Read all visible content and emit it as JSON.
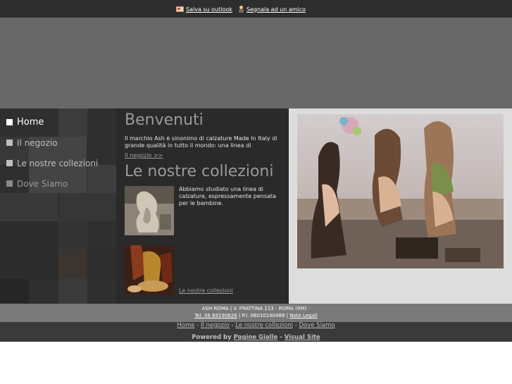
{
  "topbar": {
    "save_outlook": " Salva su outlook",
    "tell_friend": " Segnala ad un amico"
  },
  "nav": {
    "items": [
      "Home",
      "Il negozio",
      "Le nostre collezioni",
      "Dove Siamo"
    ]
  },
  "welcome": {
    "title": "Benvenuti",
    "text": "Il marchio Ash è sinonimo di calzature Made In Italy di grande qualità in tutto il mondo: una linea di",
    "more_link": "Il negozio >>"
  },
  "collections": {
    "title": "Le nostre collezioni",
    "text": "Abbiamo studiato una linea di calzature, espressamente pensata per le bambine.",
    "link": "Le nostre collezioni"
  },
  "footer": {
    "line1": "ASH ROMA | V. FRATTINA 113 - ROMA (RM) -",
    "tel": "Tel. 06 69190626",
    "piva": " | P.I. 06010140488 | ",
    "legal": "Note Legali",
    "nav": [
      "Home",
      "Il negozio",
      "Le nostre collezioni",
      "Dove Siamo"
    ],
    "powered_by": "Powered by ",
    "pagine_gialle": "Pagine Gialle",
    "dash": " - ",
    "visual_site": "Visual Site"
  }
}
